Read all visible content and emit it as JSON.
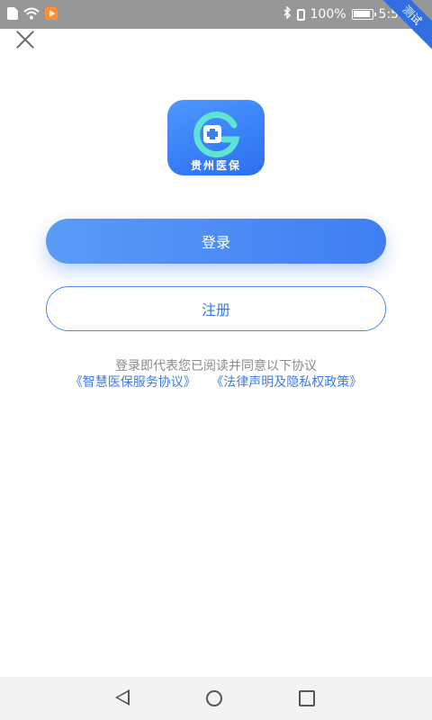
{
  "status_bar": {
    "battery": "100%",
    "time": "5:53",
    "ribbon": "测试"
  },
  "logo": {
    "text": "贵州医保"
  },
  "buttons": {
    "login": "登录",
    "register": "注册"
  },
  "agreement": {
    "text": "登录即代表您已阅读并同意以下协议",
    "link1": "《智慧医保服务协议》",
    "link2": "《法律声明及隐私权政策》"
  },
  "colors": {
    "accent": "#3f7ef2",
    "status_bar": "#979797"
  },
  "icons": [
    "sim-icon",
    "wifi-icon",
    "play-icon",
    "bluetooth-icon",
    "vibrate-icon",
    "battery-icon",
    "close-icon",
    "back-icon",
    "home-icon",
    "recent-apps-icon"
  ]
}
